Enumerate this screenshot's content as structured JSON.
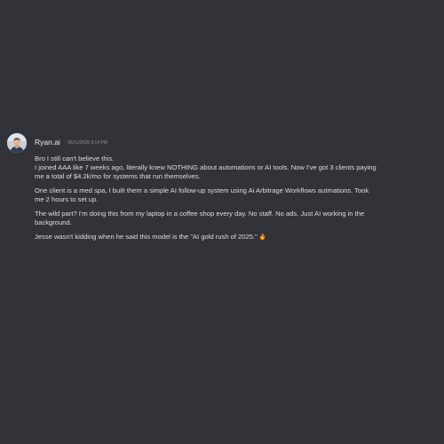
{
  "message": {
    "author": "Ryan.ai",
    "timestamp": "06/11/2025 9:14 PM",
    "avatar_icon": "user-avatar-photo",
    "emoji_icon": "fire-emoji-icon",
    "paragraphs": [
      {
        "lines": [
          "Bro I still can't believe this.",
          "I joined AAA like 7 weeks ago, literally knew NOTHING about automations or AI tools. Now I've got 3 clients paying",
          "me a total of $4.2k/mo for systems that run themselves."
        ]
      },
      {
        "lines": [
          "One client is a med spa, I built them a simple AI follow-up system using Ai Arbitrage Workflows autmations. Took",
          "me 2 hours to set up."
        ]
      },
      {
        "lines": [
          "The wild part? I'm doing this from my laptop in a coffee shop every day. No staff. No ads. Just AI working in the",
          "background."
        ]
      },
      {
        "lines": [
          "Jesse wasn't kidding when he said this model is the \"AI gold rush of 2025.\""
        ]
      }
    ]
  },
  "colors": {
    "background": "#323339",
    "username": "#eef0f3",
    "timestamp": "#8f939a",
    "body_text": "#dcdee1"
  }
}
